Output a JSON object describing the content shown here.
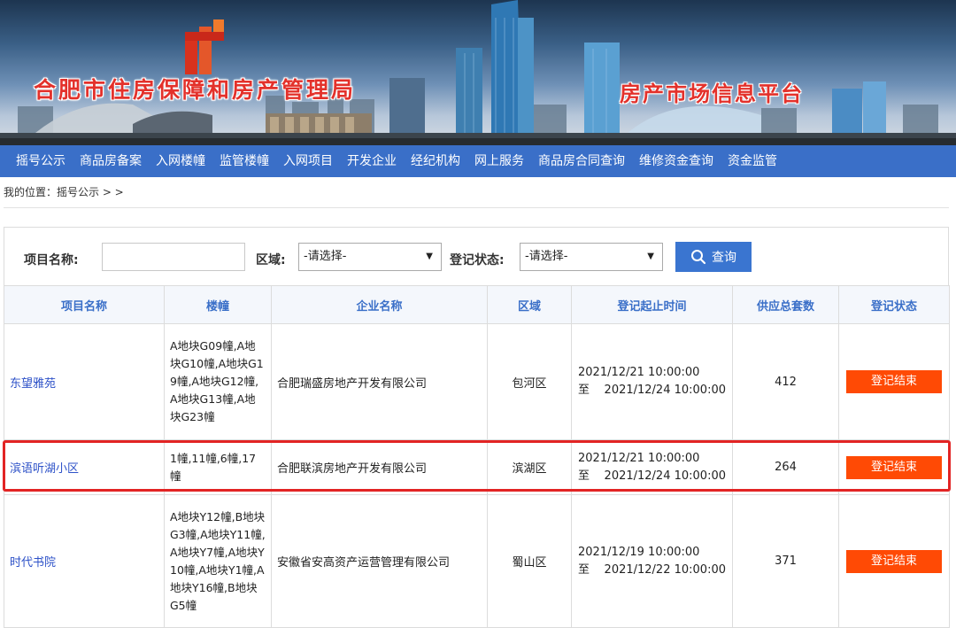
{
  "banner": {
    "title": "合肥市住房保障和房产管理局",
    "subtitle": "房产市场信息平台"
  },
  "nav": [
    "摇号公示",
    "商品房备案",
    "入网楼幢",
    "监管楼幢",
    "入网项目",
    "开发企业",
    "经纪机构",
    "网上服务",
    "商品房合同查询",
    "维修资金查询",
    "资金监管"
  ],
  "breadcrumb": "我的位置：摇号公示 > >",
  "search": {
    "project_label": "项目名称:",
    "project_value": "",
    "district_label": "区域:",
    "district_selected": "-请选择-",
    "status_label": "登记状态:",
    "status_selected": "-请选择-",
    "query_button": "查询"
  },
  "table": {
    "headers": [
      "项目名称",
      "楼幢",
      "企业名称",
      "区域",
      "登记起止时间",
      "供应总套数",
      "登记状态"
    ],
    "rows": [
      {
        "project": "东望雅苑",
        "buildings": "A地块G09幢,A地块G10幢,A地块G19幢,A地块G12幢,A地块G13幢,A地块G23幢",
        "company": "合肥瑞盛房地产开发有限公司",
        "district": "包河区",
        "start": "2021/12/21 10:00:00",
        "end_prefix": "至",
        "end": "2021/12/24 10:00:00",
        "total": "412",
        "status": "登记结束"
      },
      {
        "project": "滨语听湖小区",
        "buildings": "1幢,11幢,6幢,17幢",
        "company": "合肥联滨房地产开发有限公司",
        "district": "滨湖区",
        "start": "2021/12/21 10:00:00",
        "end_prefix": "至",
        "end": "2021/12/24 10:00:00",
        "total": "264",
        "status": "登记结束"
      },
      {
        "project": "时代书院",
        "buildings": "A地块Y12幢,B地块G3幢,A地块Y11幢,A地块Y7幢,A地块Y10幢,A地块Y1幢,A地块Y16幢,B地块G5幢",
        "company": "安徽省安高资产运营管理有限公司",
        "district": "蜀山区",
        "start": "2021/12/19 10:00:00",
        "end_prefix": "至",
        "end": "2021/12/22 10:00:00",
        "total": "371",
        "status": "登记结束"
      }
    ]
  },
  "colors": {
    "nav_bg": "#3a6fc8",
    "title_red": "#e3312b",
    "status_orange": "#ff4a05",
    "link_blue": "#2e52c8",
    "highlight_red": "#e22424"
  }
}
